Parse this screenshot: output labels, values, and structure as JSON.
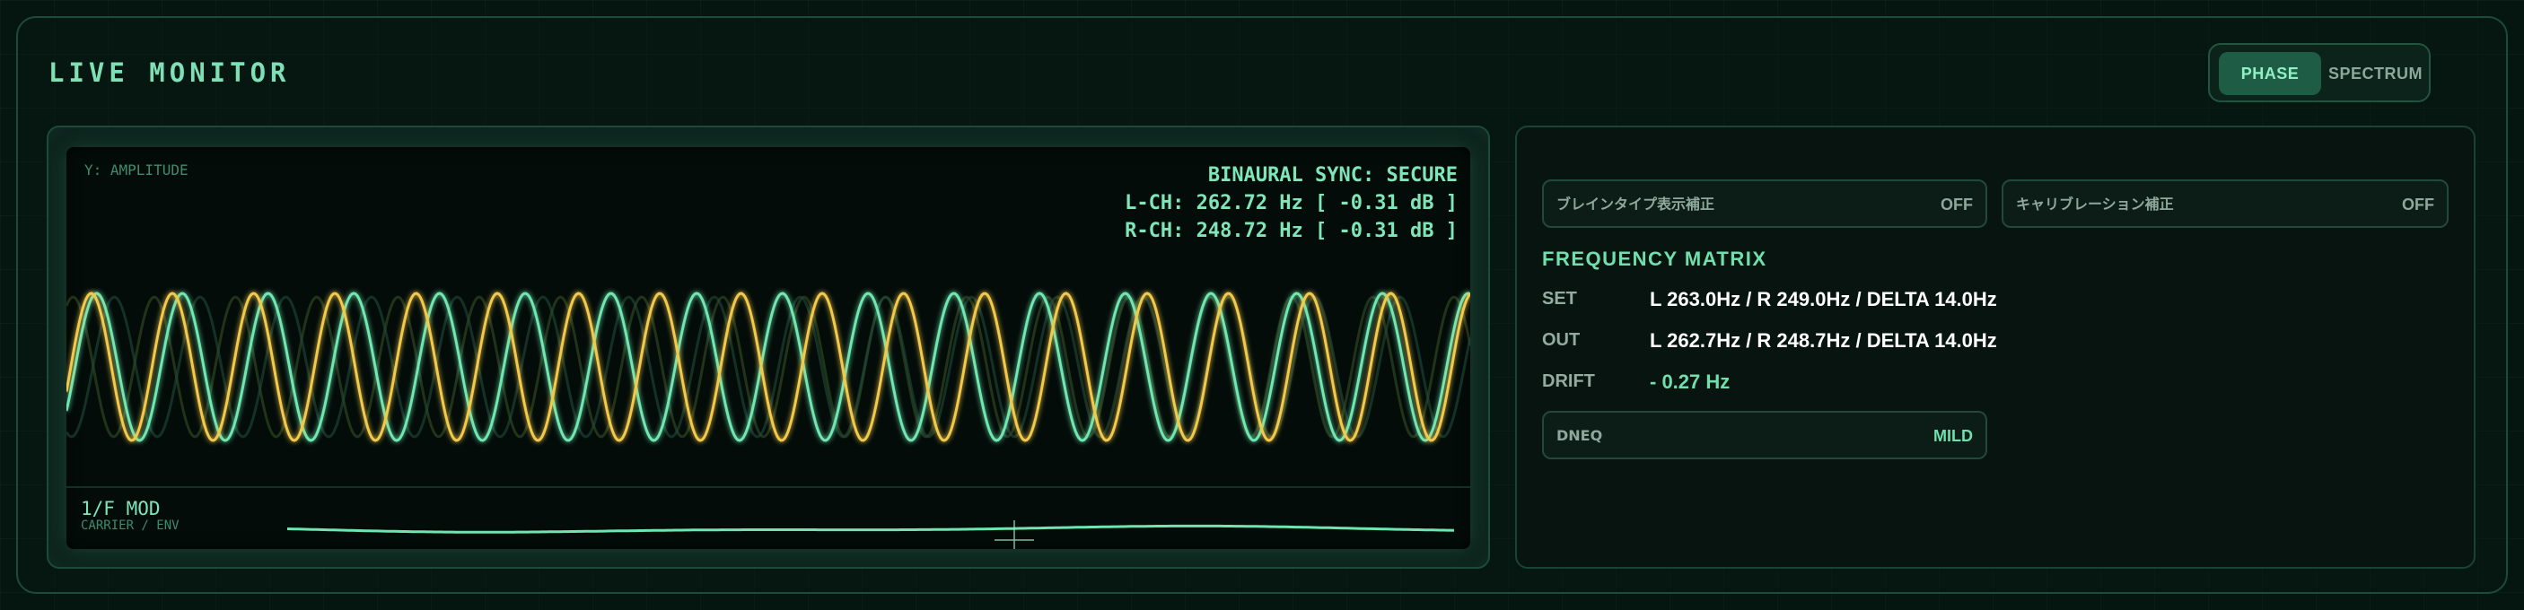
{
  "header": {
    "title": "LIVE MONITOR"
  },
  "modes": {
    "active": "PHASE",
    "other": "SPECTRUM"
  },
  "scope": {
    "y_label": "Y: AMPLITUDE",
    "sync_status": "BINAURAL SYNC: SECURE",
    "left_channel": "L-CH: 262.72 Hz [ -0.31 dB ]",
    "right_channel": "R-CH: 248.72 Hz [ -0.31 dB ]",
    "mod_label": "1/F MOD",
    "mod_sublabel": "CARRIER / ENV"
  },
  "toggles": {
    "brain_type": {
      "label": "ブレインタイプ表示補正",
      "value": "OFF"
    },
    "calibration": {
      "label": "キャリブレーション補正",
      "value": "OFF"
    }
  },
  "matrix": {
    "title": "FREQUENCY MATRIX",
    "rows": [
      {
        "key": "SET",
        "value": "L 263.0Hz / R 249.0Hz / DELTA 14.0Hz"
      },
      {
        "key": "OUT",
        "value": "L 262.7Hz / R 248.7Hz / DELTA 14.0Hz"
      },
      {
        "key": "DRIFT",
        "value": "- 0.27 Hz"
      }
    ],
    "dneq": {
      "label": "DNEQ",
      "value": "MILD"
    }
  },
  "colors": {
    "accent": "#7fe0b6",
    "left_wave": "#f2c94c",
    "right_wave": "#6fe6b0",
    "background": "#051510"
  }
}
